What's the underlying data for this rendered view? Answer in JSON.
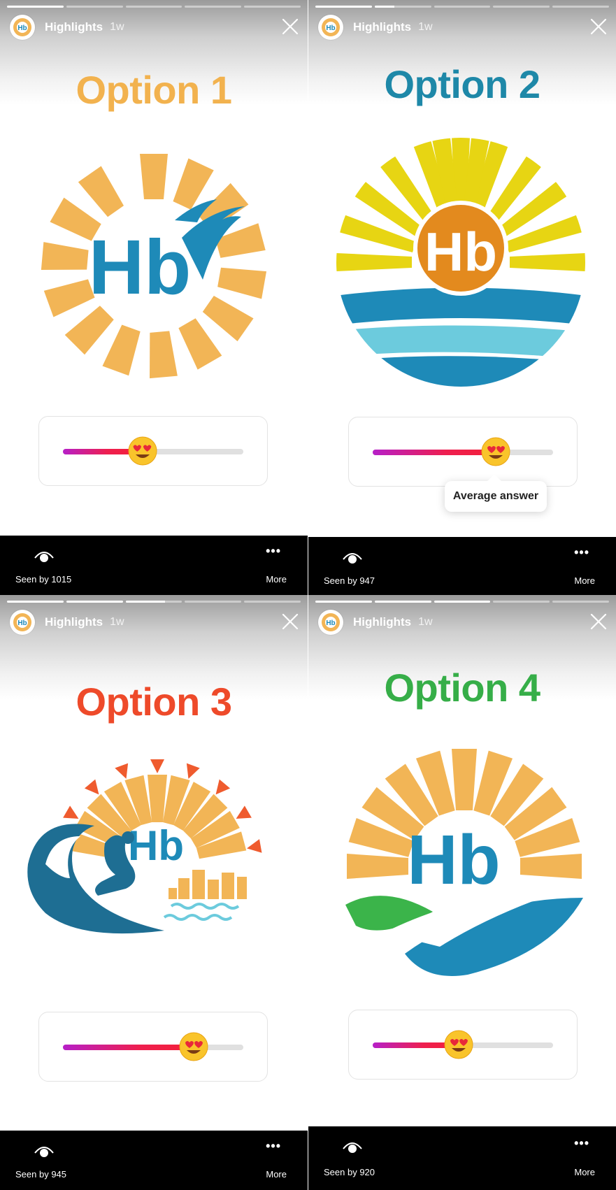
{
  "panels": [
    {
      "account_name": "Highlights",
      "time_ago": "1w",
      "title": "Option 1",
      "title_color": "#F2B24E",
      "slider_fraction": 0.41,
      "tooltip": "",
      "seen_by": "Seen by 1015",
      "more_label": "More",
      "logo_icon": "sun-bird-logo-icon"
    },
    {
      "account_name": "Highlights",
      "time_ago": "1w",
      "title": "Option 2",
      "title_color": "#1E88A8",
      "slider_fraction": 0.68,
      "tooltip": "Average answer",
      "seen_by": "Seen by 947",
      "more_label": "More",
      "logo_icon": "sun-sea-logo-icon"
    },
    {
      "account_name": "Highlights",
      "time_ago": "1w",
      "title": "Option 3",
      "title_color": "#EE4A2A",
      "slider_fraction": 0.7,
      "tooltip": "",
      "seen_by": "Seen by 945",
      "more_label": "More",
      "logo_icon": "surfer-logo-icon"
    },
    {
      "account_name": "Highlights",
      "time_ago": "1w",
      "title": "Option 4",
      "title_color": "#36AE48",
      "slider_fraction": 0.47,
      "tooltip": "",
      "seen_by": "Seen by 920",
      "more_label": "More",
      "logo_icon": "sun-wave-logo-icon"
    }
  ],
  "logo_text": "Hb",
  "colors": {
    "sun_orange": "#F2B556",
    "brand_blue": "#1E8AB8",
    "sun_yellow": "#E7D513",
    "sea_light": "#6CCBDD",
    "green": "#3BB44A",
    "red_orange": "#EF5B2E"
  }
}
